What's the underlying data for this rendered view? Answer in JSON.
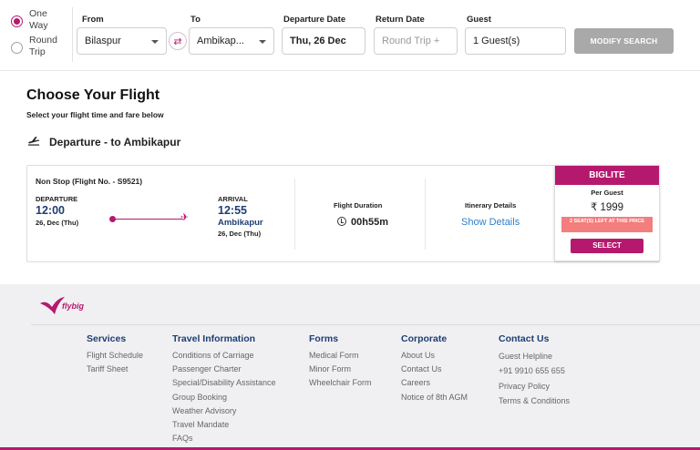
{
  "search": {
    "trip_types": [
      "One Way",
      "Round Trip"
    ],
    "selected_trip": "One Way",
    "from_label": "From",
    "from_value": "Bilaspur",
    "to_label": "To",
    "to_value": "Ambikap...",
    "departure_label": "Departure Date",
    "departure_value": "Thu, 26 Dec",
    "return_label": "Return Date",
    "return_placeholder": "Round Trip +",
    "guest_label": "Guest",
    "guest_value": "1 Guest(s)",
    "modify_label": "MODIFY SEARCH"
  },
  "heading": {
    "title": "Choose Your Flight",
    "subtitle": "Select your flight time and fare below",
    "departure_line": "Departure - to Ambikapur"
  },
  "flight": {
    "stops": "Non Stop (Flight No. - S9521)",
    "departure_label": "DEPARTURE",
    "departure_time": "12:00",
    "departure_date": "26, Dec (Thu)",
    "arrival_label": "ARRIVAL",
    "arrival_time": "12:55",
    "arrival_city": "Ambikapur",
    "arrival_date": "26, Dec (Thu)",
    "duration_label": "Flight Duration",
    "duration_value": "00h55m",
    "itinerary_label": "Itinerary Details",
    "itinerary_link": "Show Details"
  },
  "fare": {
    "name": "BIGLITE",
    "per_guest": "Per Guest",
    "price": "₹ 1999",
    "seats_left": "2 SEAT(S) LEFT AT THIS PRICE",
    "select_label": "SELECT"
  },
  "footer": {
    "brand": "flybig",
    "columns": [
      {
        "heading": "Services",
        "items": [
          "Flight Schedule",
          "Tariff Sheet"
        ]
      },
      {
        "heading": "Travel Information",
        "items": [
          "Conditions of Carriage",
          "Passenger Charter",
          "Special/Disability Assistance",
          "Group Booking",
          "Weather Advisory",
          "Travel Mandate",
          "FAQs"
        ]
      },
      {
        "heading": "Forms",
        "items": [
          "Medical Form",
          "Minor Form",
          "Wheelchair Form"
        ]
      },
      {
        "heading": "Corporate",
        "items": [
          "About Us",
          "Contact Us",
          "Careers",
          "Notice of 8th AGM"
        ]
      },
      {
        "heading": "Contact Us",
        "items": [
          "Guest Helpline",
          "+91 9910 655 655",
          "Privacy Policy",
          "Terms & Conditions"
        ]
      }
    ]
  },
  "colors": {
    "brand": "#b5196e",
    "link": "#2c7fd1",
    "navy": "#1d3e73"
  }
}
